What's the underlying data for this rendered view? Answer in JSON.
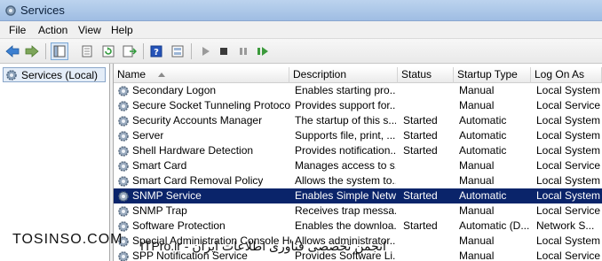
{
  "window": {
    "title": "Services"
  },
  "menu": [
    "File",
    "Action",
    "View",
    "Help"
  ],
  "toolbar": {
    "icons": [
      "back-arrow-icon",
      "forward-arrow-icon",
      "console-tree-icon",
      "properties-icon",
      "refresh-icon",
      "export-icon",
      "help-icon",
      "view-icon",
      "play-icon",
      "stop-icon",
      "pause-icon",
      "resume-icon"
    ]
  },
  "tree": {
    "root_label": "Services (Local)"
  },
  "columns": [
    "Name",
    "Description",
    "Status",
    "Startup Type",
    "Log On As"
  ],
  "rows": [
    {
      "name": "Secondary Logon",
      "description": "Enables starting pro...",
      "status": "",
      "startup": "Manual",
      "logon": "Local System"
    },
    {
      "name": "Secure Socket Tunneling Protocol ...",
      "description": "Provides support for...",
      "status": "",
      "startup": "Manual",
      "logon": "Local Service"
    },
    {
      "name": "Security Accounts Manager",
      "description": "The startup of this s...",
      "status": "Started",
      "startup": "Automatic",
      "logon": "Local System"
    },
    {
      "name": "Server",
      "description": "Supports file, print, ...",
      "status": "Started",
      "startup": "Automatic",
      "logon": "Local System"
    },
    {
      "name": "Shell Hardware Detection",
      "description": "Provides notification...",
      "status": "Started",
      "startup": "Automatic",
      "logon": "Local System"
    },
    {
      "name": "Smart Card",
      "description": "Manages access to s...",
      "status": "",
      "startup": "Manual",
      "logon": "Local Service"
    },
    {
      "name": "Smart Card Removal Policy",
      "description": "Allows the system to...",
      "status": "",
      "startup": "Manual",
      "logon": "Local System"
    },
    {
      "name": "SNMP Service",
      "description": "Enables Simple Netw...",
      "status": "Started",
      "startup": "Automatic",
      "logon": "Local System",
      "selected": true
    },
    {
      "name": "SNMP Trap",
      "description": "Receives trap messa...",
      "status": "",
      "startup": "Manual",
      "logon": "Local Service"
    },
    {
      "name": "Software Protection",
      "description": "Enables the downloa...",
      "status": "Started",
      "startup": "Automatic (D...",
      "logon": "Network S..."
    },
    {
      "name": "Special Administration Console Hel...",
      "description": "Allows administrator...",
      "status": "",
      "startup": "Manual",
      "logon": "Local System"
    },
    {
      "name": "SPP Notification Service",
      "description": "Provides Software Li...",
      "status": "",
      "startup": "Manual",
      "logon": "Local Service"
    }
  ],
  "watermarks": {
    "left": "TOSINSO.COM",
    "center": "ITPro.ir - انجمن تخصصی فناوری اطلاعات ایران"
  },
  "colors": {
    "selection": "#0a246a",
    "titlebar": "#bcd3ee"
  }
}
